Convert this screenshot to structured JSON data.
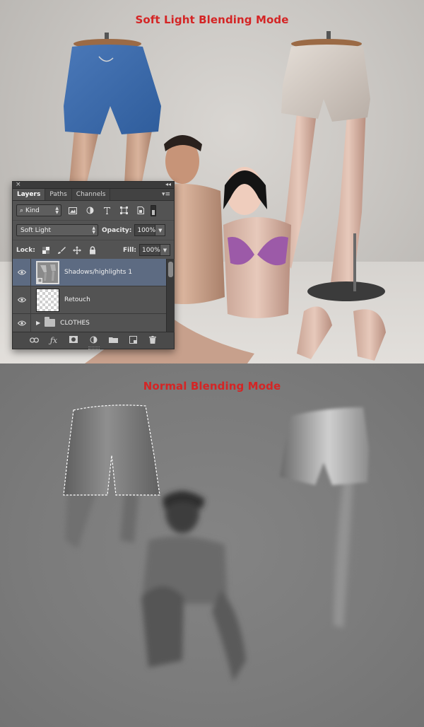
{
  "top_caption": "Soft Light Blending Mode",
  "bottom_caption": "Normal Blending Mode",
  "colors": {
    "caption_red": "#d42525",
    "panel_bg": "#535353",
    "selection": "#5d6b82"
  },
  "layers_panel": {
    "close_glyph": "×",
    "collapse_glyph": "◂◂",
    "menu_glyph": "▾≡",
    "tabs": [
      {
        "label": "Layers",
        "active": true
      },
      {
        "label": "Paths",
        "active": false
      },
      {
        "label": "Channels",
        "active": false
      }
    ],
    "filter": {
      "kind_label": "Kind"
    },
    "blend_mode": "Soft Light",
    "opacity_label": "Opacity:",
    "opacity_value": "100%",
    "lock_label": "Lock:",
    "fill_label": "Fill:",
    "fill_value": "100%",
    "layers": [
      {
        "name": "Shadows/highlights 1",
        "selected": true,
        "type": "smart"
      },
      {
        "name": "Retouch",
        "selected": false,
        "type": "empty"
      },
      {
        "name": "CLOTHES",
        "selected": false,
        "type": "group"
      }
    ],
    "footer_icons": [
      "link-icon",
      "fx-icon",
      "mask-icon",
      "adjustment-icon",
      "folder-icon",
      "new-layer-icon",
      "trash-icon"
    ]
  }
}
